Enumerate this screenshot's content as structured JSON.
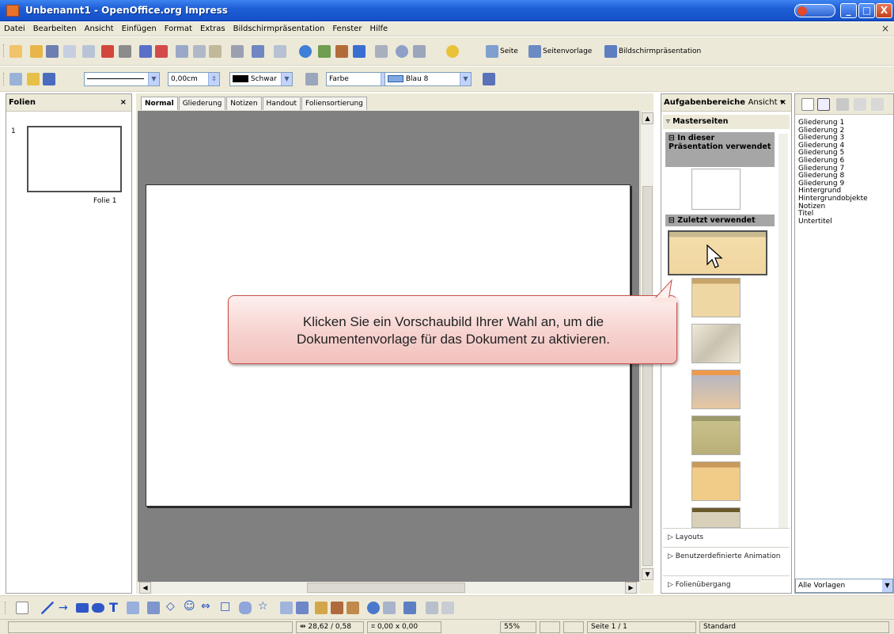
{
  "window": {
    "title": "Unbenannt1 - OpenOffice.org Impress",
    "min": "_",
    "max": "□",
    "close": "X"
  },
  "menu": [
    "Datei",
    "Bearbeiten",
    "Ansicht",
    "Einfügen",
    "Format",
    "Extras",
    "Bildschirmpräsentation",
    "Fenster",
    "Hilfe"
  ],
  "menu_close": "×",
  "toolbar_std": {
    "seite": "Seite",
    "seitenvorlage": "Seitenvorlage",
    "praesentation": "Bildschirmpräsentation"
  },
  "toolbar_line": {
    "line_width": "0,00cm",
    "line_color": "Schwar",
    "fill_type": "Farbe",
    "fill_color": "Blau 8"
  },
  "slides_panel": {
    "title": "Folien",
    "close": "×",
    "slide_number": "1",
    "slide_label": "Folie 1"
  },
  "tabs": [
    "Normal",
    "Gliederung",
    "Notizen",
    "Handout",
    "Foliensortierung"
  ],
  "task_pane": {
    "title": "Aufgabenbereiche",
    "view_menu": "Ansicht",
    "close": "×",
    "section": "Masterseiten",
    "cat_used": "In dieser Präsentation verwendet",
    "cat_recent": "Zuletzt verwendet",
    "layouts": "Layouts",
    "custom_anim": "Benutzerdefinierte Animation",
    "transition": "Folienübergang"
  },
  "styles": {
    "items": [
      "Gliederung 1",
      "Gliederung 2",
      "Gliederung 3",
      "Gliederung 4",
      "Gliederung 5",
      "Gliederung 6",
      "Gliederung 7",
      "Gliederung 8",
      "Gliederung 9",
      "Hintergrund",
      "Hintergrundobjekte",
      "Notizen",
      "Titel",
      "Untertitel"
    ],
    "filter": "Alle Vorlagen"
  },
  "callout": {
    "line1": "Klicken Sie ein Vorschaubild Ihrer Wahl an, um die",
    "line2": "Dokumentenvorlage für das Dokument zu aktivieren."
  },
  "status": {
    "position": "28,62 / 0,58",
    "size": "0,00 x 0,00",
    "zoom": "55%",
    "page": "Seite 1 / 1",
    "layout": "Standard"
  },
  "colors": {
    "accent": "#1e5fd6",
    "callout_border": "#c8504a",
    "line_color": "#000000",
    "fill_color": "#7fa9e0"
  }
}
